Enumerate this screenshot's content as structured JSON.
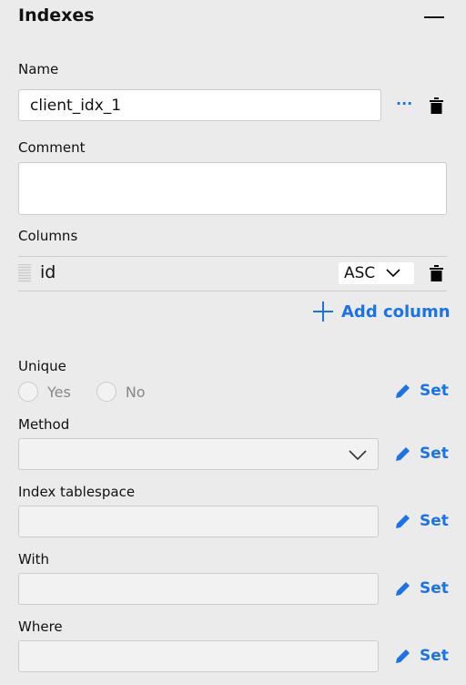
{
  "section": {
    "title": "Indexes"
  },
  "name": {
    "label": "Name",
    "value": "client_idx_1",
    "more": "···"
  },
  "comment": {
    "label": "Comment",
    "value": ""
  },
  "columns": {
    "label": "Columns",
    "rows": [
      {
        "name": "id",
        "order": "ASC"
      }
    ],
    "add_label": "Add column"
  },
  "unique": {
    "label": "Unique",
    "options": [
      "Yes",
      "No"
    ],
    "set": "Set"
  },
  "method": {
    "label": "Method",
    "value": "",
    "set": "Set"
  },
  "tablespace": {
    "label": "Index tablespace",
    "value": "",
    "set": "Set"
  },
  "with": {
    "label": "With",
    "value": "",
    "set": "Set"
  },
  "where": {
    "label": "Where",
    "value": "",
    "set": "Set"
  },
  "colors": {
    "accent": "#1a73e8"
  }
}
